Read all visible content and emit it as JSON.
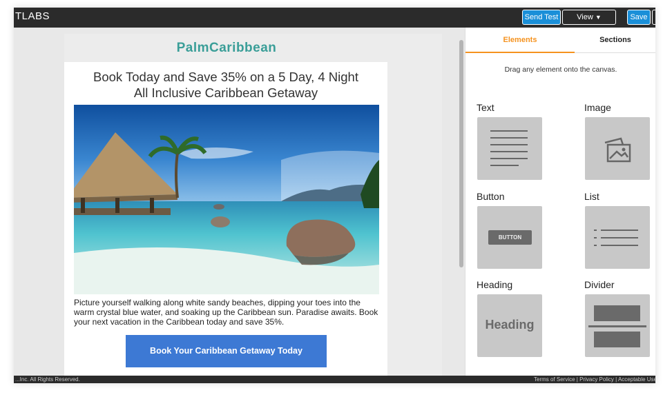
{
  "app": {
    "logo_text": "TLABS",
    "send_test_label": "Send Test",
    "view_label": "View",
    "save_label": "Save"
  },
  "email": {
    "brand": "PalmCaribbean",
    "headline_line1": "Book Today and Save 35% on a 5 Day, 4 Night",
    "headline_line2": "All Inclusive Caribbean Getaway",
    "paragraph": "Picture yourself walking along white sandy beaches, dipping your toes into the warm crystal blue water, and soaking up the Caribbean sun. Paradise awaits. Book your next vacation in the Caribbean today and save 35%.",
    "cta_label": "Book Your Caribbean Getaway Today"
  },
  "panel": {
    "tabs": [
      {
        "label": "Elements",
        "active": true
      },
      {
        "label": "Sections",
        "active": false
      }
    ],
    "hint": "Drag any element onto the canvas.",
    "elements": [
      {
        "label": "Text",
        "icon": "text-lines-icon"
      },
      {
        "label": "Image",
        "icon": "image-icon"
      },
      {
        "label": "Button",
        "icon": "button-icon",
        "preview_text": "BUTTON"
      },
      {
        "label": "List",
        "icon": "list-icon"
      },
      {
        "label": "Heading",
        "icon": "heading-icon",
        "preview_text": "Heading"
      },
      {
        "label": "Divider",
        "icon": "divider-icon"
      }
    ]
  },
  "footer": {
    "left": "...Inc. All Rights Reserved.",
    "right": "Terms of Service | Privacy Policy | Acceptable Use"
  },
  "colors": {
    "topbar": "#2b2b2b",
    "primary_button": "#1a8fd8",
    "brand_teal": "#3a9e98",
    "cta_blue": "#3d79d4",
    "active_tab": "#f5921e",
    "tile_gray": "#c8c8c8"
  }
}
